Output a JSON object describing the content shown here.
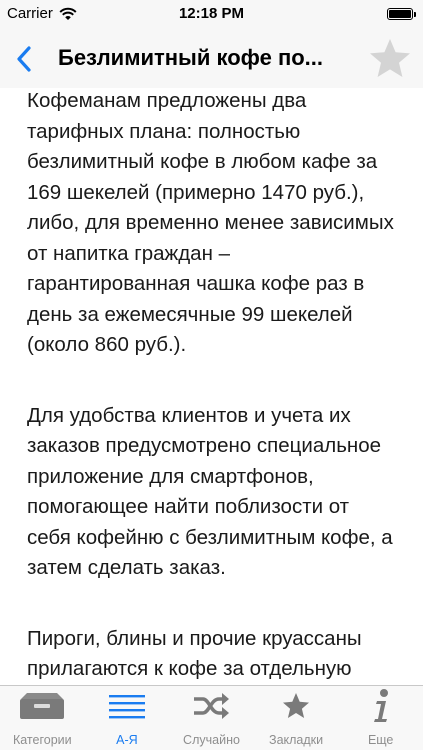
{
  "status_bar": {
    "carrier": "Carrier",
    "time": "12:18 PM",
    "battery_level": 1.0
  },
  "nav": {
    "back_icon": "chevron-left-icon",
    "title": "Безлимитный кофе по...",
    "favorite_icon": "star-icon"
  },
  "article": {
    "paragraphs": [
      "Кофеманам предложены два тарифных плана: полностью безлимитный кофе в любом кафе за 169 шекелей (примерно 1470 руб.), либо, для временно менее зависимых от напитка граждан – гарантированная чашка кофе раз в день за ежемесячные 99 шекелей (около 860 руб.).",
      "Для удобства клиентов и учета их заказов предусмотрено специальное приложение для смартфонов, помогающее найти поблизости от себя кофейню с безлимитным кофе, а затем сделать заказ.",
      "Пироги, блины и прочие круассаны прилагаются к кофе за отдельную плату. Поэтому, пока, кажется, что за бесплатный кофе в кофейне будет"
    ]
  },
  "tabs": [
    {
      "label": "Категории",
      "icon": "inbox-tray-icon",
      "active": false
    },
    {
      "label": "А-Я",
      "icon": "list-lines-icon",
      "active": true
    },
    {
      "label": "Случайно",
      "icon": "shuffle-icon",
      "active": false
    },
    {
      "label": "Закладки",
      "icon": "star-icon",
      "active": false
    },
    {
      "label": "Еще",
      "icon": "info-icon",
      "active": false
    }
  ],
  "colors": {
    "accent": "#1a7cf0",
    "tab_inactive": "#8e8e8e",
    "bar_background": "#f7f7f7"
  }
}
